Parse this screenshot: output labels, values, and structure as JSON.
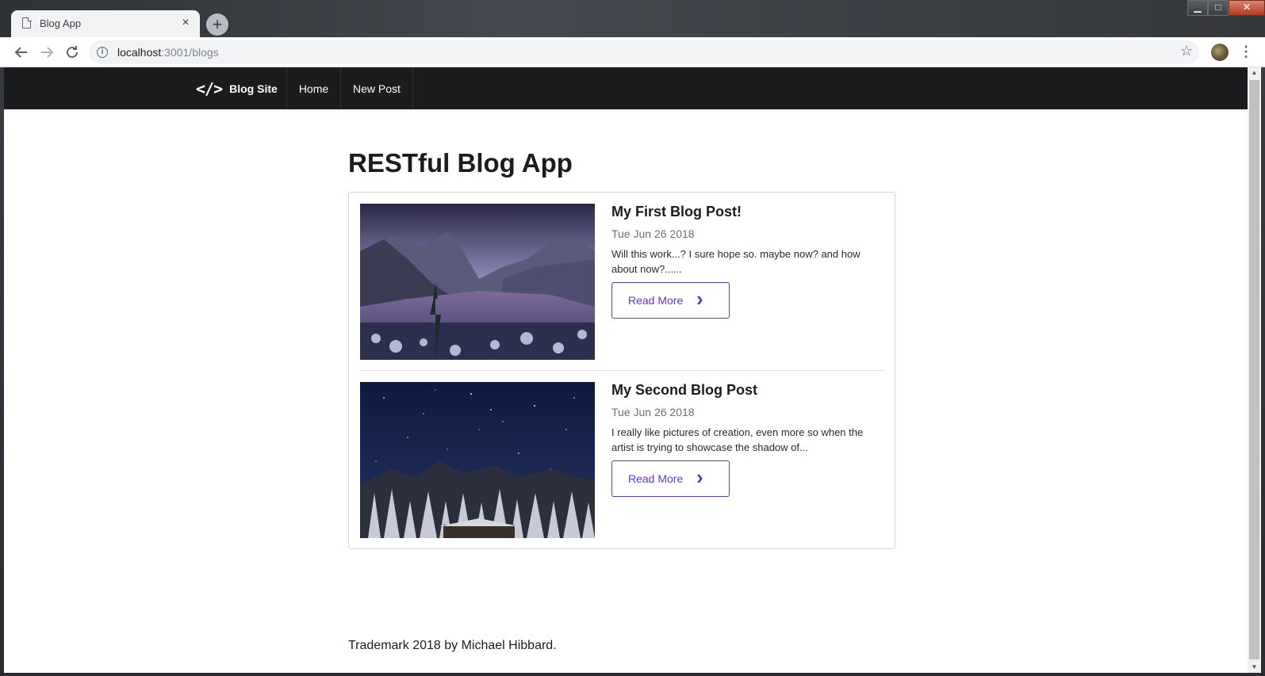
{
  "browser": {
    "tab_title": "Blog App",
    "tab_close": "×",
    "new_tab": "+",
    "url_host": "localhost",
    "url_path": ":3001/blogs",
    "window_controls": {
      "minimize": "▁",
      "maximize": "□",
      "close": "✕"
    }
  },
  "site": {
    "brand_icon": "</>",
    "brand_name": "Blog Site",
    "nav": [
      {
        "label": "Home"
      },
      {
        "label": "New Post"
      }
    ]
  },
  "page": {
    "title": "RESTful Blog App",
    "posts": [
      {
        "title": "My First Blog Post!",
        "date": "Tue Jun 26 2018",
        "excerpt": "Will this work...? I sure hope so. maybe now? and how about now?......",
        "button": "Read More",
        "image": "snowy-mountain-valley"
      },
      {
        "title": "My Second Blog Post",
        "date": "Tue Jun 26 2018",
        "excerpt": "I really like pictures of creation, even more so when the artist is trying to showcase the shadow of...",
        "button": "Read More",
        "image": "starry-night-snowy-forest"
      }
    ],
    "footer": "Trademark 2018 by Michael Hibbard."
  },
  "colors": {
    "nav_bg": "#1b1c1d",
    "accent_violet": "#6435c9"
  }
}
